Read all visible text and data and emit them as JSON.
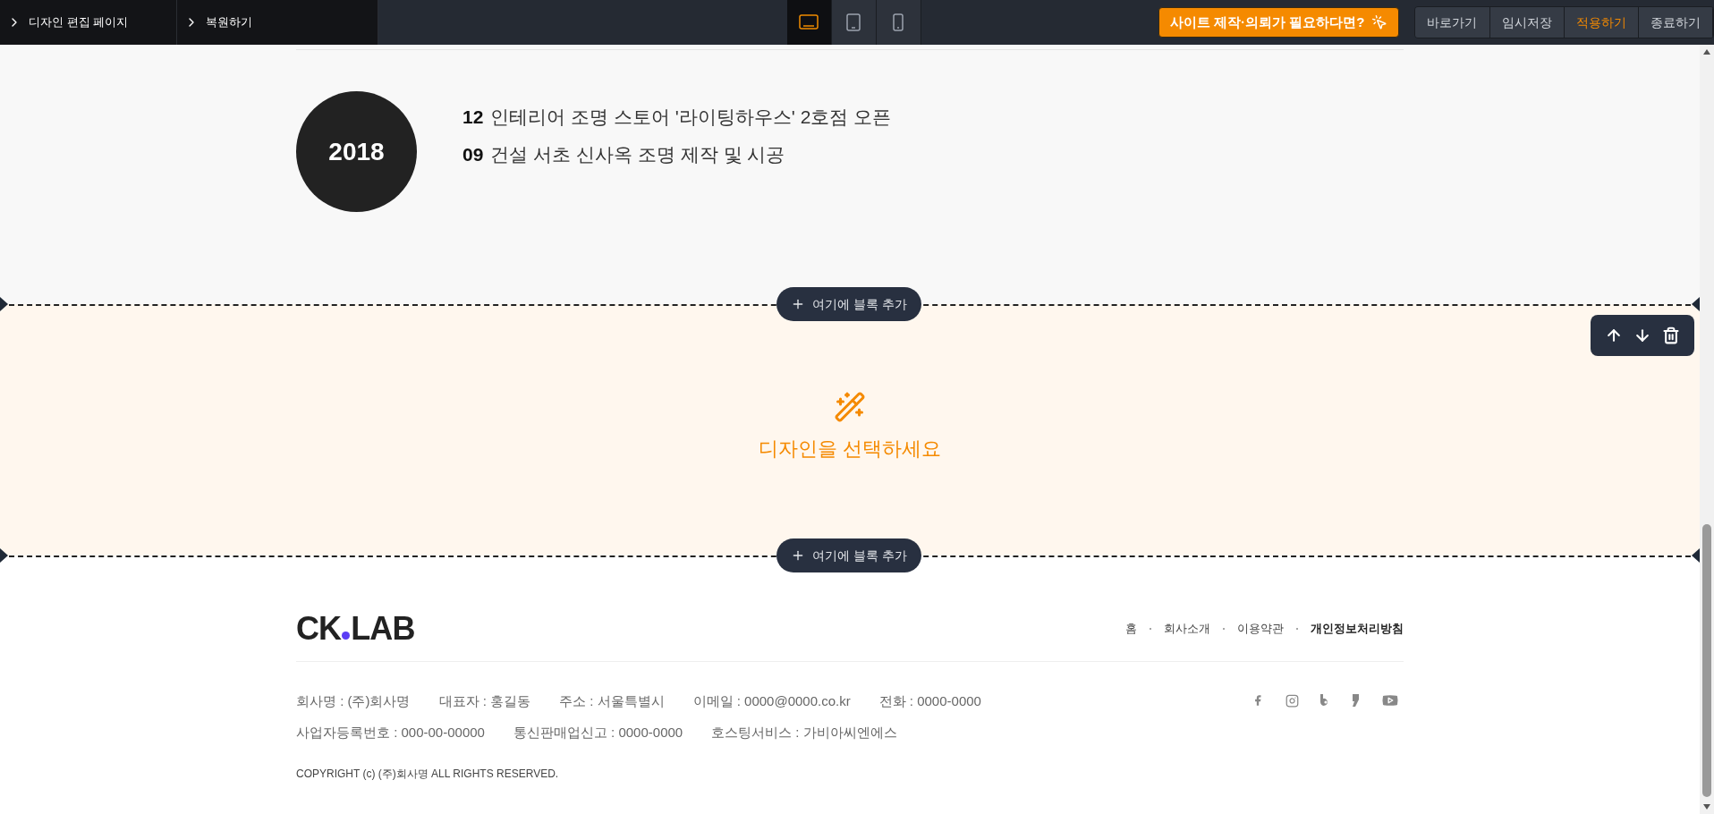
{
  "toolbar": {
    "breadcrumbs": [
      {
        "label": "디자인 편집 페이지"
      },
      {
        "label": "복원하기"
      }
    ],
    "devices": [
      {
        "kind": "desktop",
        "selected": true
      },
      {
        "kind": "tablet",
        "selected": false
      },
      {
        "kind": "mobile",
        "selected": false
      }
    ],
    "promo_button": "사이트 제작·의뢰가 필요하다면?",
    "actions": [
      {
        "label": "바로가기",
        "selected": false
      },
      {
        "label": "임시저장",
        "selected": false
      },
      {
        "label": "적용하기",
        "selected": true
      },
      {
        "label": "종료하기",
        "selected": false
      }
    ]
  },
  "history": {
    "year": "2018",
    "entries": [
      {
        "month": "12",
        "text": "인테리어 조명 스토어 '라이팅하우스' 2호점 오픈"
      },
      {
        "month": "09",
        "text": "건설 서초 신사옥 조명 제작 및 시공"
      }
    ]
  },
  "add_block_buttons": [
    "여기에 블록 추가",
    "여기에 블록 추가"
  ],
  "empty_block": {
    "message": "디자인을 선택하세요"
  },
  "footer": {
    "logo": [
      "CK",
      "LAB"
    ],
    "links": [
      {
        "label": "홈",
        "selected": false
      },
      {
        "label": "회사소개",
        "selected": false
      },
      {
        "label": "이용약관",
        "selected": false
      },
      {
        "label": "개인정보처리방침",
        "selected": true
      }
    ],
    "info_rows": [
      [
        "회사명 : (주)회사명",
        "대표자 : 홍길동",
        "주소 : 서울특별시",
        "이메일 : 0000@0000.co.kr",
        "전화 : 0000-0000"
      ],
      [
        "사업자등록번호 : 000-00-00000",
        "통신판매업신고 : 0000-0000",
        "호스팅서비스 : 가비아씨엔에스"
      ]
    ],
    "copyright": "COPYRIGHT (c) (주)회사명 ALL RIGHTS RESERVED."
  }
}
